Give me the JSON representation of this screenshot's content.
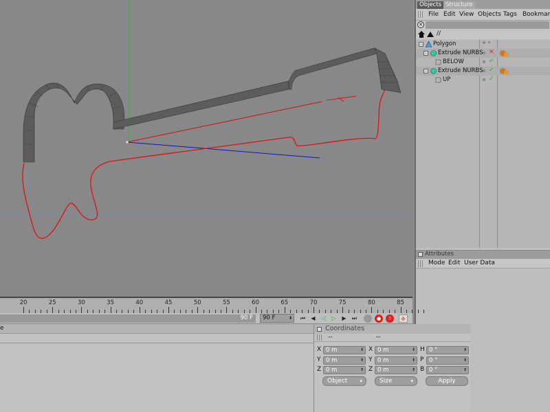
{
  "objects_panel": {
    "tabs": [
      "Objects",
      "Structure"
    ],
    "menu": [
      "File",
      "Edit",
      "View",
      "Objects",
      "Tags",
      "Bookmarks"
    ],
    "path": "//",
    "tree": [
      {
        "label": "Polygon",
        "icon": "polygon-icon"
      },
      {
        "label": "Extrude NURBS",
        "icon": "extrude-nurbs-icon"
      },
      {
        "label": "BELOW",
        "icon": "spline-icon"
      },
      {
        "label": "Extrude NURBS",
        "icon": "extrude-nurbs-icon"
      },
      {
        "label": "UP",
        "icon": "spline-icon"
      }
    ]
  },
  "attributes_panel": {
    "title": "Attributes",
    "menu": [
      "Mode",
      "Edit",
      "User Data"
    ]
  },
  "timeline": {
    "ticks": [
      "20",
      "25",
      "30",
      "35",
      "40",
      "45",
      "50",
      "55",
      "60",
      "65",
      "70",
      "75",
      "80",
      "85"
    ],
    "end_frame_label": "90 F",
    "frame_field": "90 F"
  },
  "bottom_left": {
    "partial_text": "e"
  },
  "coordinates": {
    "title": "Coordinates",
    "header_left": "--",
    "header_right": "--",
    "rows": [
      {
        "a_label": "X",
        "a_val": "0 m",
        "b_label": "X",
        "b_val": "0 m",
        "c_label": "H",
        "c_val": "0 °"
      },
      {
        "a_label": "Y",
        "a_val": "0 m",
        "b_label": "Y",
        "b_val": "0 m",
        "c_label": "P",
        "c_val": "0 °"
      },
      {
        "a_label": "Z",
        "a_val": "0 m",
        "b_label": "Z",
        "b_val": "0 m",
        "c_label": "B",
        "c_val": "0 °"
      }
    ],
    "mode_dropdown": "Object",
    "size_dropdown": "Size",
    "apply_label": "Apply"
  },
  "colors": {
    "viewport_bg": "#888888",
    "spline": "#e01010",
    "axis_x": "#cc1111",
    "axis_y": "#22cc22",
    "axis_z": "#1111cc"
  }
}
